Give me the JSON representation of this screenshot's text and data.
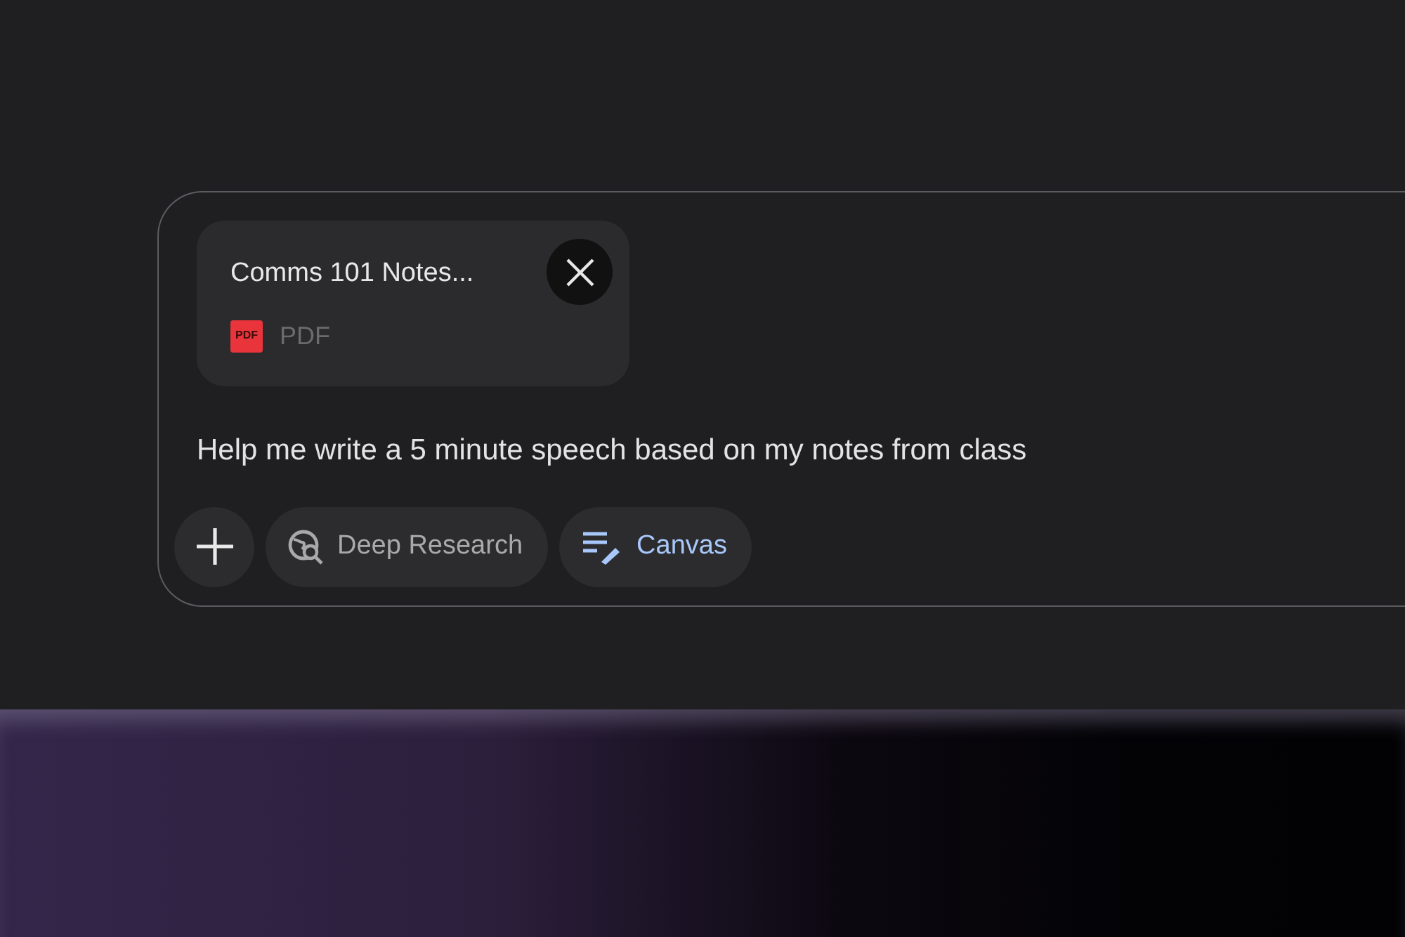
{
  "attachment": {
    "name": "Comms 101 Notes...",
    "icon_label": "PDF",
    "type_label": "PDF"
  },
  "prompt": {
    "value": "Help me write a 5 minute speech based on my notes from class"
  },
  "tools": [
    {
      "kind": "plus"
    },
    {
      "kind": "deep-research",
      "label": "Deep Research",
      "selected": false
    },
    {
      "kind": "canvas",
      "label": "Canvas",
      "selected": true
    }
  ]
}
